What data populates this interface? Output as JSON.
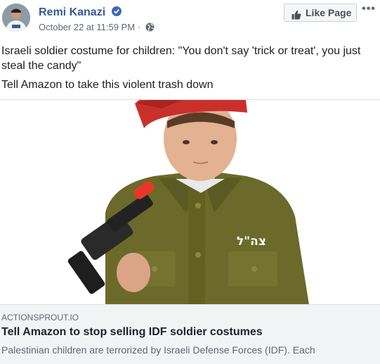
{
  "post": {
    "author": "Remi Kanazi",
    "timestamp": "October 22 at 11:59 PM",
    "separator": "·",
    "privacy_icon": "globe-icon",
    "verified_icon": "verified-badge-icon",
    "text_line1": "Israeli soldier costume for children: \"You don't say 'trick or treat', you just steal the candy\"",
    "text_line2": "Tell Amazon to take this violent trash down"
  },
  "actions": {
    "like_page_label": "Like Page",
    "more_label": "•••"
  },
  "link_preview": {
    "domain": "ACTIONSPROUT.IO",
    "headline": "Tell Amazon to stop selling IDF soldier costumes",
    "description": "Palestinian children are terrorized by Israeli Defense Forces (IDF). Each",
    "image_badge_text": "צה\"ל"
  },
  "colors": {
    "author_blue": "#385898",
    "verified_blue": "#4267b2",
    "meta_gray": "#606770",
    "beret_red": "#c9302c",
    "uniform_olive": "#6b6a2a"
  }
}
